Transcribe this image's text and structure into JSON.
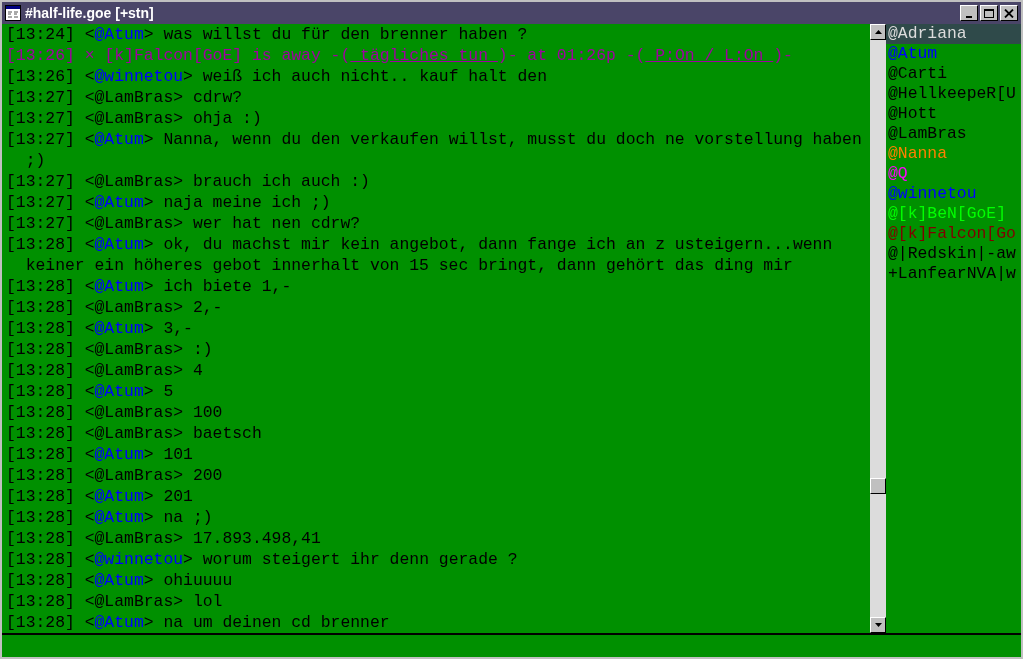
{
  "window": {
    "title": "#half-life.goe [+stn]"
  },
  "messages": [
    {
      "kind": "message",
      "time": "[13:24]",
      "open": "<",
      "nick": "@Atum",
      "close": ">",
      "color": "#0000ff",
      "text": "was willst du für den brenner haben ?"
    },
    {
      "kind": "action",
      "time": "[13:26]",
      "segments": [
        {
          "text": "× [k]Falcon[GoE] is away -(",
          "underlined": false
        },
        {
          "text": " tägliches tun ",
          "underlined": true
        },
        {
          "text": ")- at 01:26p -(",
          "underlined": false
        },
        {
          "text": " P:On / L:On ",
          "underlined": true
        },
        {
          "text": ")-",
          "underlined": false
        }
      ]
    },
    {
      "kind": "message",
      "time": "[13:26]",
      "open": "<",
      "nick": "@winnetou",
      "close": ">",
      "color": "#0000ff",
      "text": "weiß ich auch nicht.. kauf halt den"
    },
    {
      "kind": "message",
      "time": "[13:27]",
      "open": "<",
      "nick": "@LamBras",
      "close": ">",
      "color": "#000000",
      "text": "cdrw?"
    },
    {
      "kind": "message",
      "time": "[13:27]",
      "open": "<",
      "nick": "@LamBras",
      "close": ">",
      "color": "#000000",
      "text": "ohja :)"
    },
    {
      "kind": "message",
      "time": "[13:27]",
      "open": "<",
      "nick": "@Atum",
      "close": ">",
      "color": "#0000ff",
      "text": "Nanna, wenn du den verkaufen willst, musst du doch ne vorstellung haben ;)"
    },
    {
      "kind": "message",
      "time": "[13:27]",
      "open": "<",
      "nick": "@LamBras",
      "close": ">",
      "color": "#000000",
      "text": "brauch ich auch :)"
    },
    {
      "kind": "message",
      "time": "[13:27]",
      "open": "<",
      "nick": "@Atum",
      "close": ">",
      "color": "#0000ff",
      "text": "naja meine ich ;)"
    },
    {
      "kind": "message",
      "time": "[13:27]",
      "open": "<",
      "nick": "@LamBras",
      "close": ">",
      "color": "#000000",
      "text": "wer hat nen cdrw?"
    },
    {
      "kind": "message",
      "time": "[13:28]",
      "open": "<",
      "nick": "@Atum",
      "close": ">",
      "color": "#0000ff",
      "text": "ok, du machst mir kein angebot, dann fange ich an z usteigern...wenn keiner ein höheres gebot innerhalt von 15 sec bringt, dann gehört das ding mir"
    },
    {
      "kind": "message",
      "time": "[13:28]",
      "open": "<",
      "nick": "@Atum",
      "close": ">",
      "color": "#0000ff",
      "text": "ich biete 1,-"
    },
    {
      "kind": "message",
      "time": "[13:28]",
      "open": "<",
      "nick": "@LamBras",
      "close": ">",
      "color": "#000000",
      "text": "2,-"
    },
    {
      "kind": "message",
      "time": "[13:28]",
      "open": "<",
      "nick": "@Atum",
      "close": ">",
      "color": "#0000ff",
      "text": "3,-"
    },
    {
      "kind": "message",
      "time": "[13:28]",
      "open": "<",
      "nick": "@LamBras",
      "close": ">",
      "color": "#000000",
      "text": ":)"
    },
    {
      "kind": "message",
      "time": "[13:28]",
      "open": "<",
      "nick": "@LamBras",
      "close": ">",
      "color": "#000000",
      "text": "4"
    },
    {
      "kind": "message",
      "time": "[13:28]",
      "open": "<",
      "nick": "@Atum",
      "close": ">",
      "color": "#0000ff",
      "text": "5"
    },
    {
      "kind": "message",
      "time": "[13:28]",
      "open": "<",
      "nick": "@LamBras",
      "close": ">",
      "color": "#000000",
      "text": "100"
    },
    {
      "kind": "message",
      "time": "[13:28]",
      "open": "<",
      "nick": "@LamBras",
      "close": ">",
      "color": "#000000",
      "text": "baetsch"
    },
    {
      "kind": "message",
      "time": "[13:28]",
      "open": "<",
      "nick": "@Atum",
      "close": ">",
      "color": "#0000ff",
      "text": "101"
    },
    {
      "kind": "message",
      "time": "[13:28]",
      "open": "<",
      "nick": "@LamBras",
      "close": ">",
      "color": "#000000",
      "text": "200"
    },
    {
      "kind": "message",
      "time": "[13:28]",
      "open": "<",
      "nick": "@Atum",
      "close": ">",
      "color": "#0000ff",
      "text": "201"
    },
    {
      "kind": "message",
      "time": "[13:28]",
      "open": "<",
      "nick": "@Atum",
      "close": ">",
      "color": "#0000ff",
      "text": "na ;)"
    },
    {
      "kind": "message",
      "time": "[13:28]",
      "open": "<",
      "nick": "@LamBras",
      "close": ">",
      "color": "#000000",
      "text": "17.893.498,41"
    },
    {
      "kind": "message",
      "time": "[13:28]",
      "open": "<",
      "nick": "@winnetou",
      "close": ">",
      "color": "#0000ff",
      "text": "worum steigert ihr denn gerade ?"
    },
    {
      "kind": "message",
      "time": "[13:28]",
      "open": "<",
      "nick": "@Atum",
      "close": ">",
      "color": "#0000ff",
      "text": "ohiuuuu"
    },
    {
      "kind": "message",
      "time": "[13:28]",
      "open": "<",
      "nick": "@LamBras",
      "close": ">",
      "color": "#000000",
      "text": "lol"
    },
    {
      "kind": "message",
      "time": "[13:28]",
      "open": "<",
      "nick": "@Atum",
      "close": ">",
      "color": "#0000ff",
      "text": "na um deinen cd brenner"
    }
  ],
  "nicklist": [
    {
      "name": "@Adriana",
      "color": "#dcdcdc",
      "selected": true
    },
    {
      "name": "@Atum",
      "color": "#0000ff",
      "selected": false
    },
    {
      "name": "@Carti",
      "color": "#000000",
      "selected": false
    },
    {
      "name": "@HellkeepeR[U",
      "color": "#000000",
      "selected": false
    },
    {
      "name": "@Hott",
      "color": "#000000",
      "selected": false
    },
    {
      "name": "@LamBras",
      "color": "#000000",
      "selected": false
    },
    {
      "name": "@Nanna",
      "color": "#ff8000",
      "selected": false
    },
    {
      "name": "@Q",
      "color": "#ff00ff",
      "selected": false
    },
    {
      "name": "@winnetou",
      "color": "#0000ff",
      "selected": false
    },
    {
      "name": "@[k]BeN[GoE]",
      "color": "#00ff00",
      "selected": false
    },
    {
      "name": "@[k]Falcon[Go",
      "color": "#800000",
      "selected": false
    },
    {
      "name": "@|Redskin|-aw",
      "color": "#000000",
      "selected": false
    },
    {
      "name": "+LanfearNVA|w",
      "color": "#000000",
      "selected": false
    }
  ]
}
